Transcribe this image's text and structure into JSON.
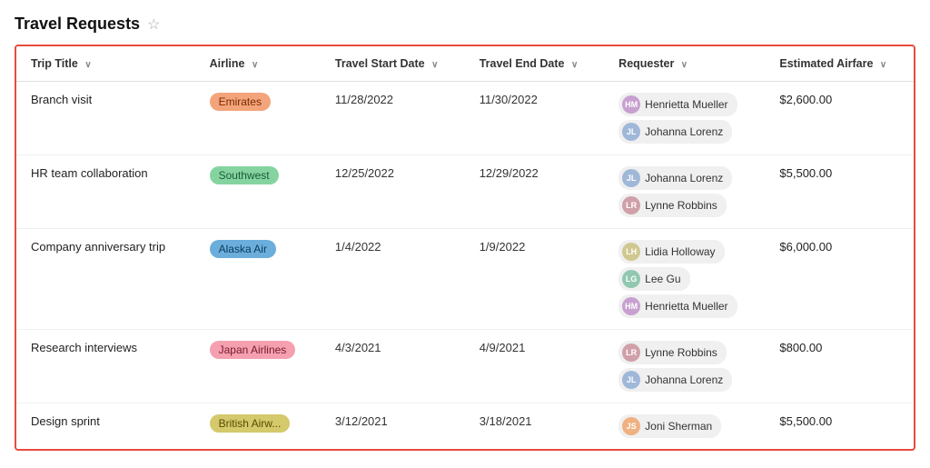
{
  "header": {
    "title": "Travel Requests",
    "star_label": "☆"
  },
  "columns": [
    {
      "key": "trip_title",
      "label": "Trip Title",
      "sortable": true
    },
    {
      "key": "airline",
      "label": "Airline",
      "sortable": true
    },
    {
      "key": "travel_start_date",
      "label": "Travel Start Date",
      "sortable": true
    },
    {
      "key": "travel_end_date",
      "label": "Travel End Date",
      "sortable": true
    },
    {
      "key": "requester",
      "label": "Requester",
      "sortable": true
    },
    {
      "key": "estimated_airfare",
      "label": "Estimated Airfare",
      "sortable": true
    }
  ],
  "rows": [
    {
      "trip_title": "Branch visit",
      "airline": "Emirates",
      "airline_class": "badge-emirates",
      "travel_start_date": "11/28/2022",
      "travel_end_date": "11/30/2022",
      "requesters": [
        {
          "name": "Henrietta Mueller",
          "initials": "HM",
          "av_class": "av-hm"
        },
        {
          "name": "Johanna Lorenz",
          "initials": "JL",
          "av_class": "av-jl"
        }
      ],
      "estimated_airfare": "$2,600.00"
    },
    {
      "trip_title": "HR team collaboration",
      "airline": "Southwest",
      "airline_class": "badge-southwest",
      "travel_start_date": "12/25/2022",
      "travel_end_date": "12/29/2022",
      "requesters": [
        {
          "name": "Johanna Lorenz",
          "initials": "JL",
          "av_class": "av-jl"
        },
        {
          "name": "Lynne Robbins",
          "initials": "LR",
          "av_class": "av-lr"
        }
      ],
      "estimated_airfare": "$5,500.00"
    },
    {
      "trip_title": "Company anniversary trip",
      "airline": "Alaska Air",
      "airline_class": "badge-alaskaair",
      "travel_start_date": "1/4/2022",
      "travel_end_date": "1/9/2022",
      "requesters": [
        {
          "name": "Lidia Holloway",
          "initials": "LH",
          "av_class": "av-lh"
        },
        {
          "name": "Lee Gu",
          "initials": "LG",
          "av_class": "av-lg"
        },
        {
          "name": "Henrietta Mueller",
          "initials": "HM",
          "av_class": "av-hm"
        }
      ],
      "estimated_airfare": "$6,000.00"
    },
    {
      "trip_title": "Research interviews",
      "airline": "Japan Airlines",
      "airline_class": "badge-japan",
      "travel_start_date": "4/3/2021",
      "travel_end_date": "4/9/2021",
      "requesters": [
        {
          "name": "Lynne Robbins",
          "initials": "LR",
          "av_class": "av-lr"
        },
        {
          "name": "Johanna Lorenz",
          "initials": "JL",
          "av_class": "av-jl"
        }
      ],
      "estimated_airfare": "$800.00"
    },
    {
      "trip_title": "Design sprint",
      "airline": "British Airw...",
      "airline_class": "badge-british",
      "travel_start_date": "3/12/2021",
      "travel_end_date": "3/18/2021",
      "requesters": [
        {
          "name": "Joni Sherman",
          "initials": "JS",
          "av_class": "av-js"
        }
      ],
      "estimated_airfare": "$5,500.00"
    }
  ]
}
